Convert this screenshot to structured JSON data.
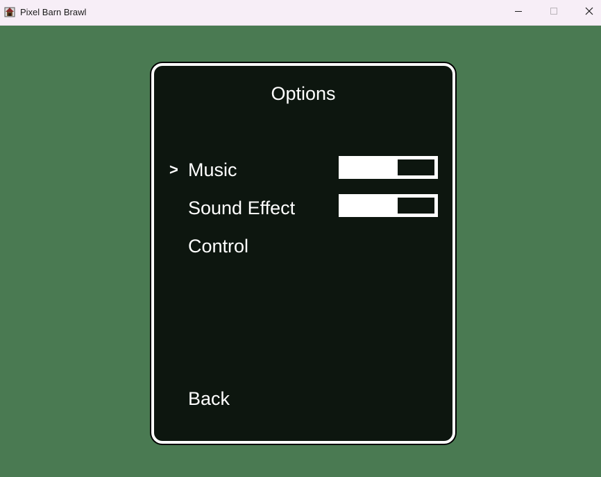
{
  "window": {
    "title": "Pixel Barn Brawl",
    "icon": "pixel-barn-brawl-app-icon"
  },
  "window_controls": [
    {
      "name": "minimize",
      "glyph": "─"
    },
    {
      "name": "maximize",
      "glyph": "☐"
    },
    {
      "name": "close",
      "glyph": "✕"
    }
  ],
  "options_menu": {
    "title": "Options",
    "cursor": ">",
    "selected_item": "Music",
    "items": [
      {
        "label": "Music",
        "volume_fraction": 0.6
      },
      {
        "label": "Sound Effect",
        "volume_fraction": 0.6
      },
      {
        "label": "Control"
      },
      {
        "label": "Back"
      }
    ]
  },
  "colors": {
    "background": "#4a7a52",
    "panel": "#0d160f",
    "panel_border": "#ffffff",
    "text": "#ffffff",
    "titlebar": "#f7eef7"
  }
}
